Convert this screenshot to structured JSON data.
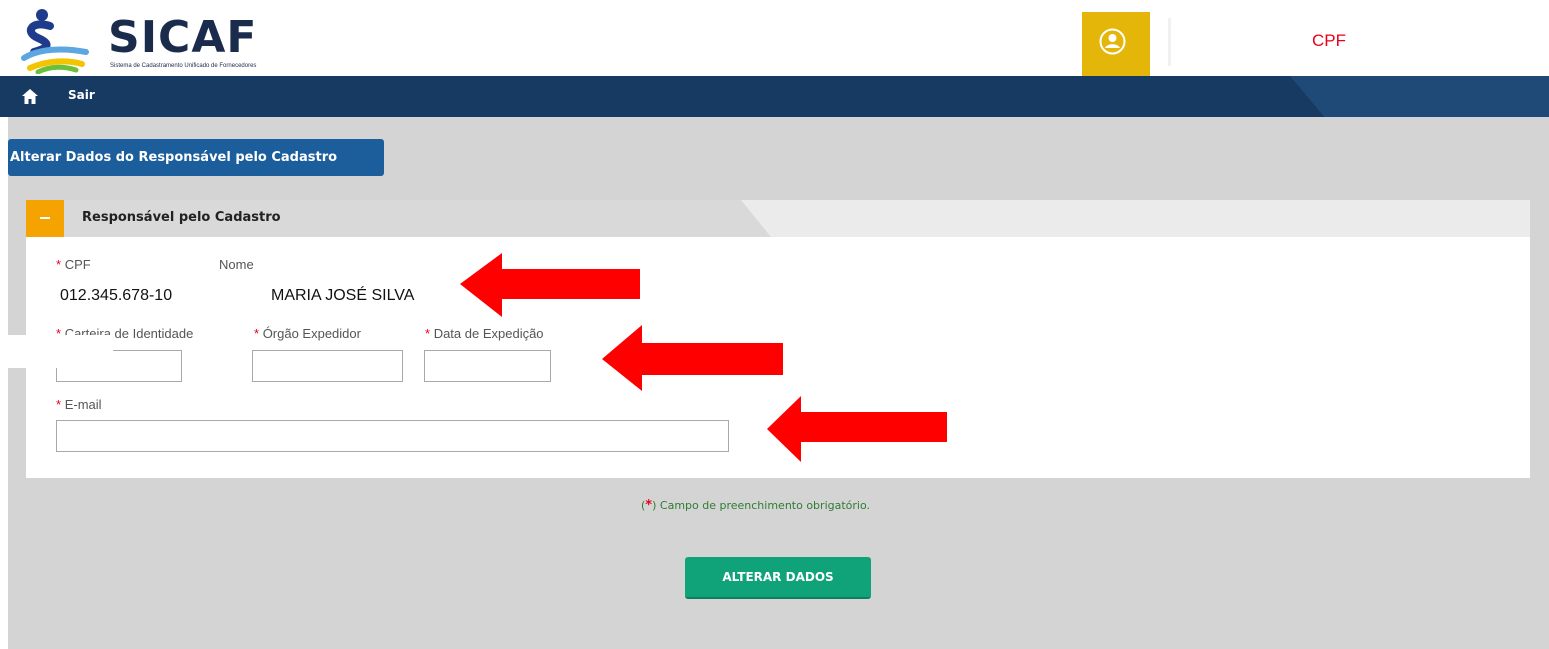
{
  "header": {
    "logo_title": "SICAF",
    "logo_subtitle": "Sistema de Cadastramento Unificado de Fornecedores",
    "user_cpf_label": "CPF"
  },
  "navbar": {
    "home_icon": "home-icon",
    "exit_label": "Sair"
  },
  "page": {
    "title": "Alterar Dados do Responsável pelo Cadastro"
  },
  "panel": {
    "title": "Responsável pelo Cadastro",
    "fields": {
      "cpf_label": "CPF",
      "cpf_value": "012.345.678-10",
      "nome_label": "Nome",
      "nome_value": "MARIA JOSÉ SILVA",
      "identidade_label": "Carteira de Identidade",
      "identidade_value": "",
      "orgao_label": "Órgão Expedidor",
      "orgao_value": "",
      "data_label": "Data de Expedição",
      "data_value": "",
      "email_label": "E-mail",
      "email_value": ""
    },
    "required_marker": "*"
  },
  "footer": {
    "note_open": "(",
    "note_star": "*",
    "note_text": ") Campo de preenchimento obrigatório.",
    "submit_label": "ALTERAR DADOS"
  },
  "colors": {
    "navy": "#173a63",
    "title_blue": "#1c5e9c",
    "gold": "#e5b60a",
    "orange": "#f5a300",
    "green": "#10a37a",
    "red": "#e8001c",
    "background": "#d4d4d4"
  }
}
